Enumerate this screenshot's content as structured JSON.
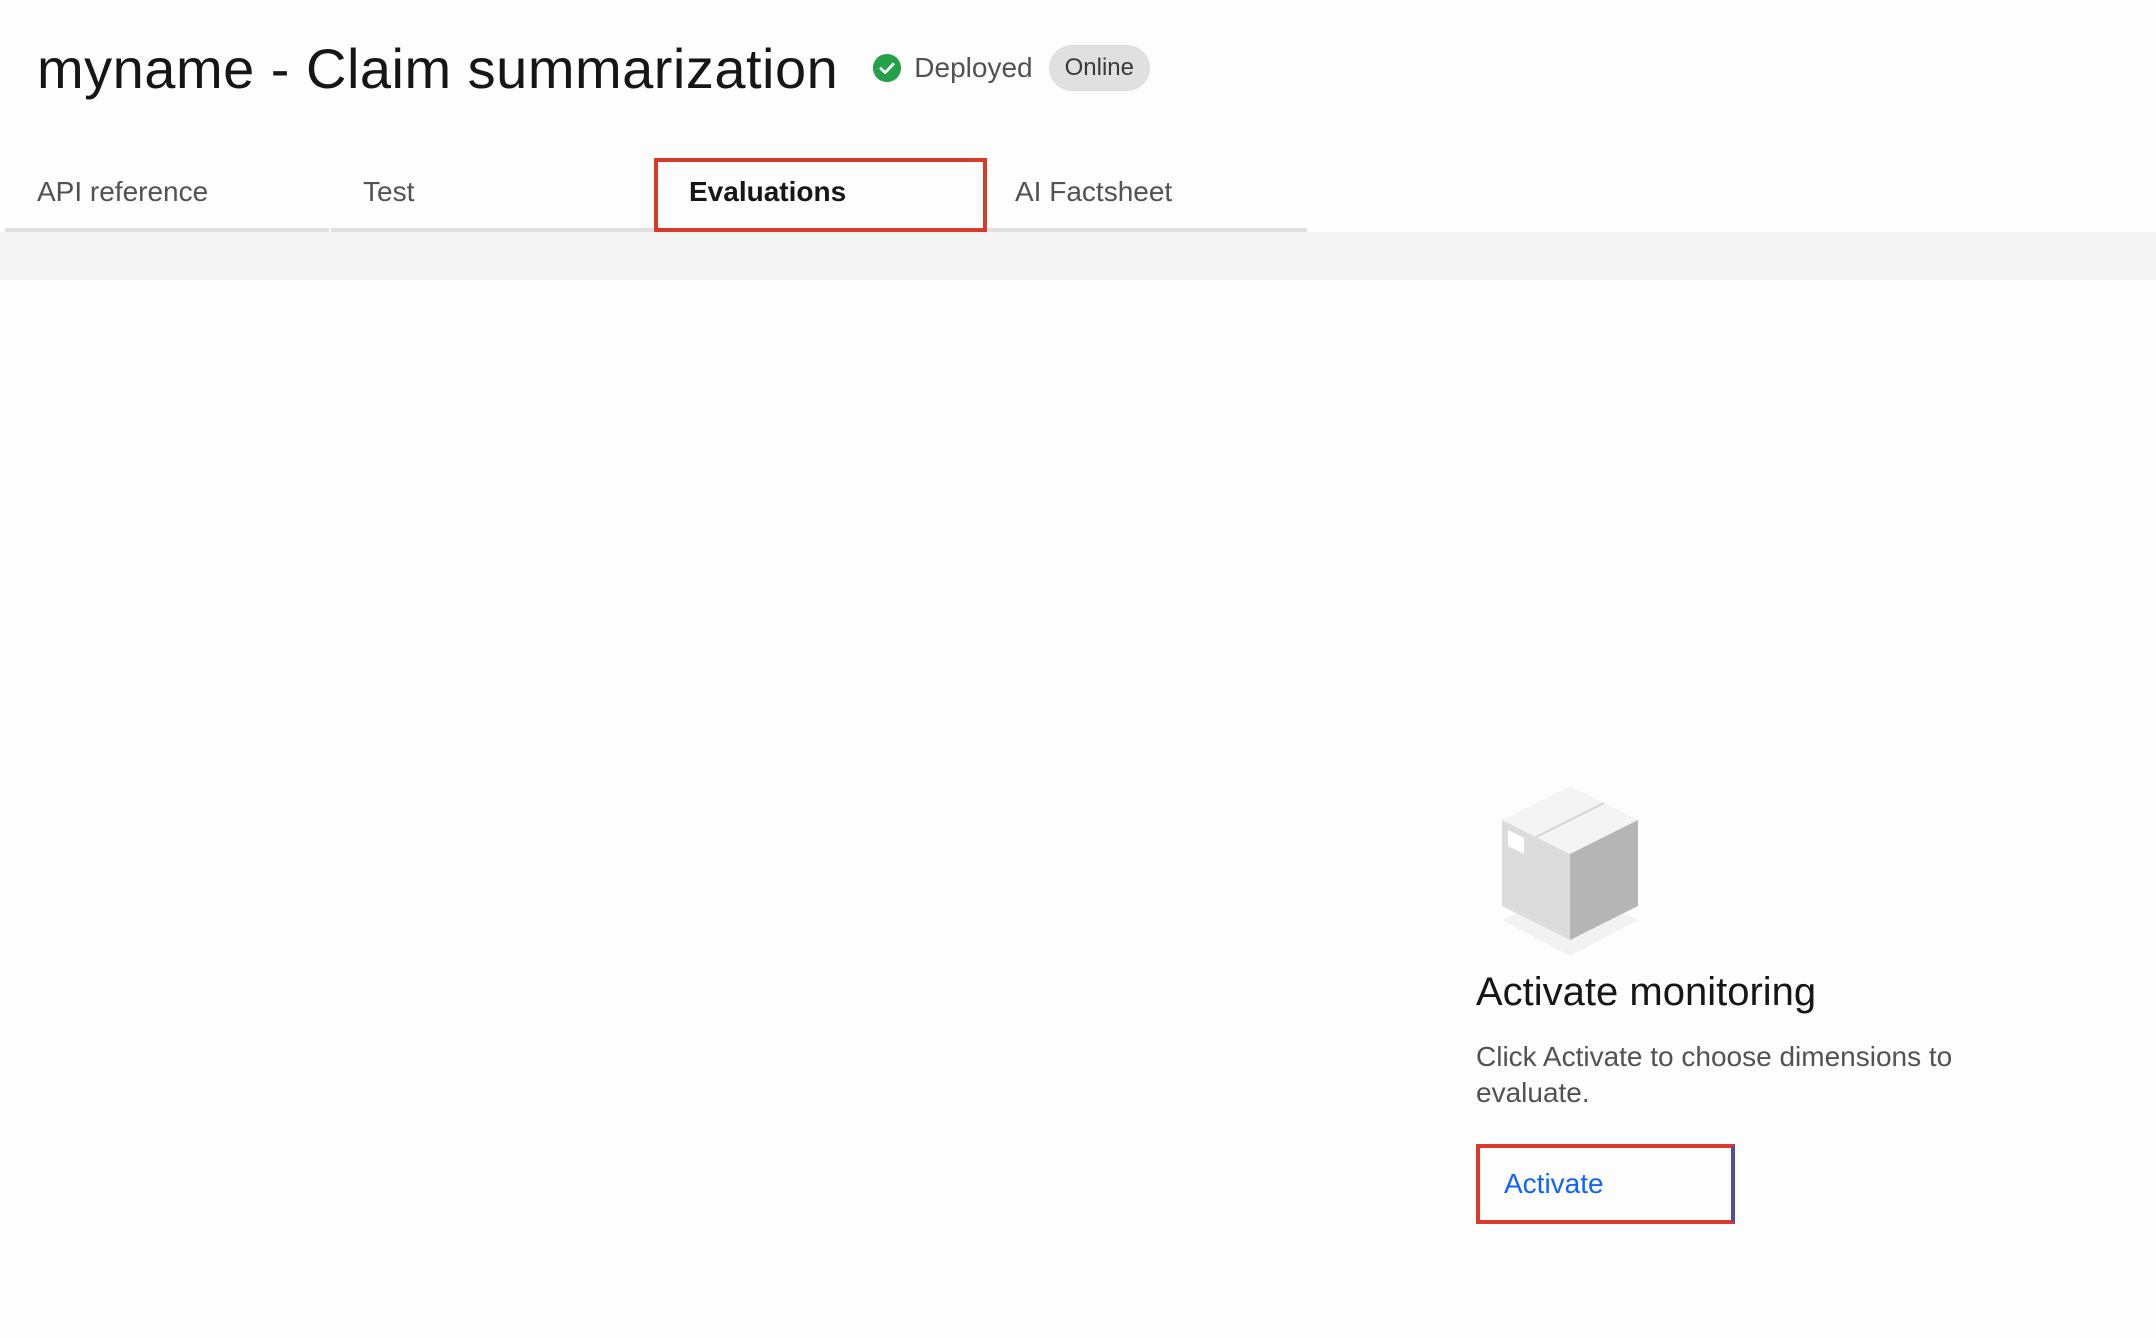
{
  "header": {
    "title": "myname - Claim summarization",
    "status": {
      "label": "Deployed",
      "icon": "checkmark-filled-icon",
      "color": "#24a148"
    },
    "badge": "Online"
  },
  "tabs": [
    {
      "label": "API reference",
      "selected": false
    },
    {
      "label": "Test",
      "selected": false
    },
    {
      "label": "Evaluations",
      "selected": true
    },
    {
      "label": "AI Factsheet",
      "selected": false
    }
  ],
  "empty_state": {
    "illustration": "box-icon",
    "title": "Activate monitoring",
    "description": "Click Activate to choose dimensions to evaluate.",
    "action_label": "Activate"
  },
  "colors": {
    "link": "#0f62fe",
    "highlight": "#da3a2a",
    "status_success": "#24a148",
    "tag_background": "#e0e0e0",
    "strip_background": "#f4f4f4"
  }
}
